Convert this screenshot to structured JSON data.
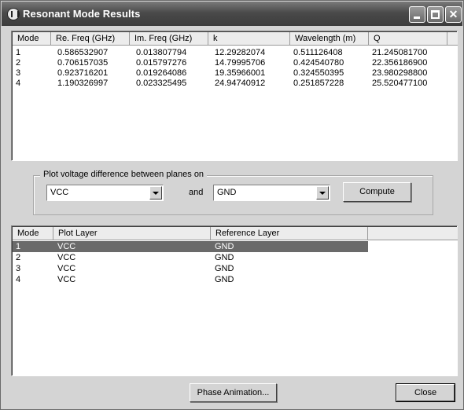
{
  "window": {
    "title": "Resonant Mode Results"
  },
  "results_table": {
    "headers": [
      "Mode",
      "Re. Freq (GHz)",
      "Im. Freq (GHz)",
      "k",
      "Wavelength (m)",
      "Q"
    ],
    "rows": [
      [
        "1",
        "0.586532907",
        "0.013807794",
        "12.29282074",
        "0.511126408",
        "21.245081700"
      ],
      [
        "2",
        "0.706157035",
        "0.015797276",
        "14.79995706",
        "0.424540780",
        "22.356186900"
      ],
      [
        "3",
        "0.923716201",
        "0.019264086",
        "19.35966001",
        "0.324550395",
        "23.980298800"
      ],
      [
        "4",
        "1.190326997",
        "0.023325495",
        "24.94740912",
        "0.251857228",
        "25.520477100"
      ]
    ]
  },
  "plot_group": {
    "label": "Plot voltage difference between planes on",
    "layer_value": "VCC",
    "and_label": "and",
    "reference_value": "GND",
    "compute_label": "Compute"
  },
  "layers_table": {
    "headers": [
      "Mode",
      "Plot Layer",
      "Reference Layer"
    ],
    "rows": [
      [
        "1",
        "VCC",
        "GND"
      ],
      [
        "2",
        "VCC",
        "GND"
      ],
      [
        "3",
        "VCC",
        "GND"
      ],
      [
        "4",
        "VCC",
        "GND"
      ]
    ],
    "selected_row": 0
  },
  "footer": {
    "phase_animation_label": "Phase Animation...",
    "close_label": "Close"
  }
}
